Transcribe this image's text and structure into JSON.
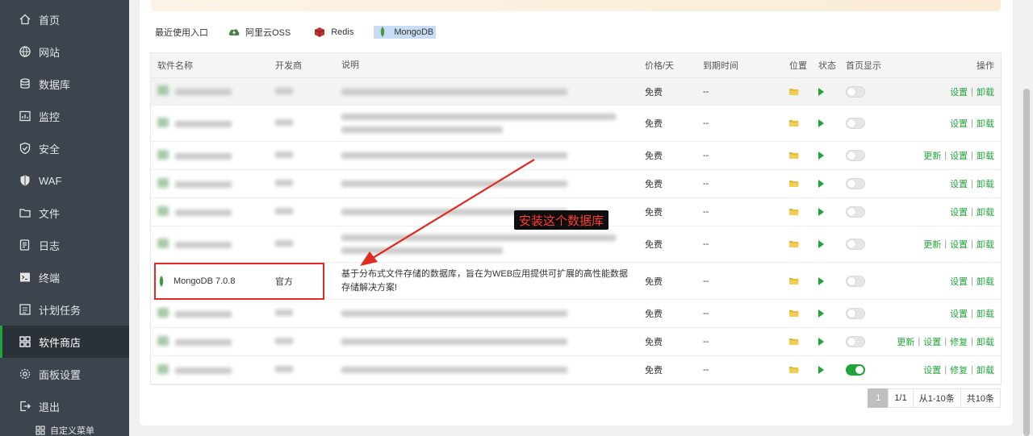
{
  "sidebar": {
    "items": [
      {
        "label": "首页",
        "icon": "home-icon"
      },
      {
        "label": "网站",
        "icon": "globe-icon"
      },
      {
        "label": "数据库",
        "icon": "database-icon"
      },
      {
        "label": "监控",
        "icon": "monitor-icon"
      },
      {
        "label": "安全",
        "icon": "shield-icon"
      },
      {
        "label": "WAF",
        "icon": "waf-shield-icon"
      },
      {
        "label": "文件",
        "icon": "folder-icon"
      },
      {
        "label": "日志",
        "icon": "log-icon"
      },
      {
        "label": "终端",
        "icon": "terminal-icon"
      },
      {
        "label": "计划任务",
        "icon": "clock-icon"
      },
      {
        "label": "软件商店",
        "icon": "grid-icon",
        "active": true
      },
      {
        "label": "面板设置",
        "icon": "gear-icon"
      },
      {
        "label": "退出",
        "icon": "logout-icon"
      }
    ],
    "sub_label": "自定义菜单",
    "accent": "#20a53a"
  },
  "recent": {
    "title": "最近使用入口",
    "items": [
      "阿里云OSS",
      "Redis",
      "MongoDB"
    ]
  },
  "table": {
    "headers": [
      "软件名称",
      "开发商",
      "说明",
      "价格/天",
      "到期时间",
      "位置",
      "状态",
      "首页显示",
      "操作"
    ],
    "rows": [
      {
        "name": "",
        "dev": "",
        "desc": "",
        "price": "免费",
        "expire": "--",
        "home_on": false,
        "ops": [
          "设置",
          "卸载"
        ],
        "blurred": true,
        "two_line": false
      },
      {
        "name": "",
        "dev": "",
        "desc": "",
        "price": "免费",
        "expire": "--",
        "home_on": false,
        "ops": [
          "设置",
          "卸载"
        ],
        "blurred": true,
        "two_line": true
      },
      {
        "name": "",
        "dev": "",
        "desc": "",
        "price": "免费",
        "expire": "--",
        "home_on": false,
        "ops": [
          "更新",
          "设置",
          "卸载"
        ],
        "blurred": true,
        "two_line": false
      },
      {
        "name": "",
        "dev": "",
        "desc": "",
        "price": "免费",
        "expire": "--",
        "home_on": false,
        "ops": [
          "设置",
          "卸载"
        ],
        "blurred": true,
        "two_line": false
      },
      {
        "name": "",
        "dev": "",
        "desc": "",
        "price": "免费",
        "expire": "--",
        "home_on": false,
        "ops": [
          "设置",
          "卸载"
        ],
        "blurred": true,
        "two_line": false
      },
      {
        "name": "",
        "dev": "",
        "desc": "",
        "price": "免费",
        "expire": "--",
        "home_on": false,
        "ops": [
          "更新",
          "设置",
          "卸载"
        ],
        "blurred": true,
        "two_line": true
      },
      {
        "name": "MongoDB 7.0.8",
        "dev": "官方",
        "desc": "基于分布式文件存储的数据库，旨在为WEB应用提供可扩展的高性能数据存储解决方案!",
        "price": "免费",
        "expire": "--",
        "home_on": false,
        "ops": [
          "设置",
          "卸载"
        ],
        "blurred": false,
        "two_line": true
      },
      {
        "name": "",
        "dev": "",
        "desc": "",
        "price": "免费",
        "expire": "--",
        "home_on": false,
        "ops": [
          "设置",
          "卸载"
        ],
        "blurred": true,
        "two_line": false
      },
      {
        "name": "",
        "dev": "",
        "desc": "",
        "price": "免费",
        "expire": "--",
        "home_on": false,
        "ops": [
          "更新",
          "设置",
          "修复",
          "卸载"
        ],
        "blurred": true,
        "two_line": false
      },
      {
        "name": "",
        "dev": "",
        "desc": "",
        "price": "免费",
        "expire": "--",
        "home_on": true,
        "ops": [
          "设置",
          "修复",
          "卸载"
        ],
        "blurred": true,
        "two_line": false
      }
    ]
  },
  "annotation": {
    "tag_text": "安装这个数据库",
    "color": "#e02a22"
  },
  "pagination": {
    "current": "1",
    "pages": "1/1",
    "range": "从1-10条",
    "total": "共10条"
  }
}
